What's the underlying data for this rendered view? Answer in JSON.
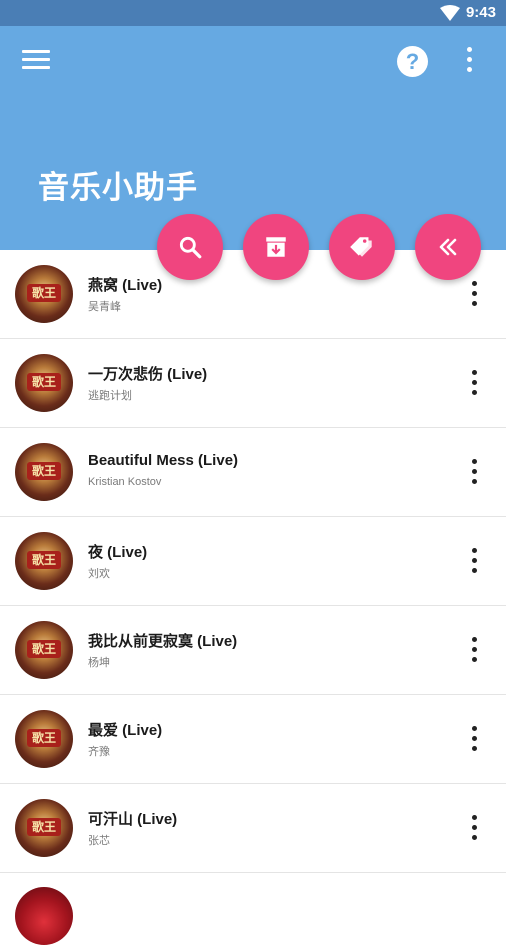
{
  "status_bar": {
    "time": "9:43"
  },
  "app_bar": {
    "title": "音乐小助手",
    "help_glyph": "?"
  },
  "fabs": [
    {
      "icon": "search-icon"
    },
    {
      "icon": "archive-download-icon"
    },
    {
      "icon": "tags-icon"
    },
    {
      "icon": "double-chevron-left-icon"
    }
  ],
  "cover": {
    "badge_text": "歌王"
  },
  "songs": [
    {
      "title": "燕窝 (Live)",
      "artist": "吴青峰"
    },
    {
      "title": "一万次悲伤 (Live)",
      "artist": "逃跑计划"
    },
    {
      "title": "Beautiful Mess (Live)",
      "artist": "Kristian Kostov"
    },
    {
      "title": "夜 (Live)",
      "artist": "刘欢"
    },
    {
      "title": "我比从前更寂寞 (Live)",
      "artist": "杨坤"
    },
    {
      "title": "最爱 (Live)",
      "artist": "齐豫"
    },
    {
      "title": "可汗山 (Live)",
      "artist": "张芯"
    }
  ],
  "colors": {
    "app_bar": "#66a9e2",
    "status_bar": "#4a7eb5",
    "fab": "#f0457f"
  }
}
